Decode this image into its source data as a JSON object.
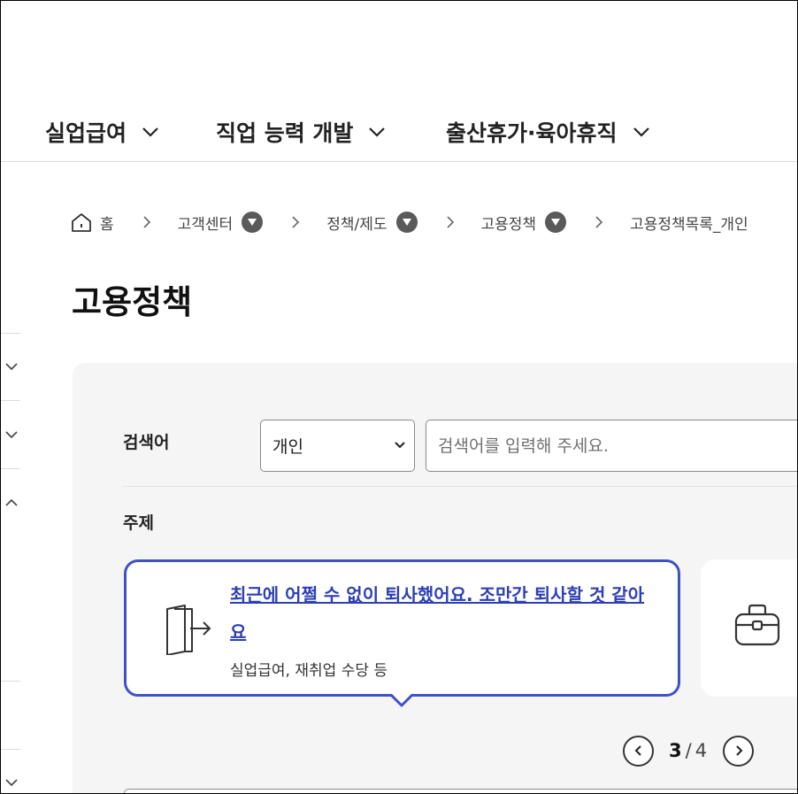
{
  "nav": {
    "items": [
      {
        "label": "실업급여"
      },
      {
        "label": "직업 능력 개발"
      },
      {
        "label": "출산휴가·육아휴직"
      }
    ]
  },
  "breadcrumb": {
    "home": "홈",
    "items": [
      {
        "label": "고객센터",
        "has_dropdown": true
      },
      {
        "label": "정책/제도",
        "has_dropdown": true
      },
      {
        "label": "고용정책",
        "has_dropdown": true
      },
      {
        "label": "고용정책목록_개인",
        "has_dropdown": false
      }
    ]
  },
  "page": {
    "title": "고용정책"
  },
  "search": {
    "label": "검색어",
    "select_value": "개인",
    "placeholder": "검색어를 입력해 주세요."
  },
  "topic": {
    "label": "주제",
    "cards": [
      {
        "title": "최근에 어쩔 수 없이 퇴사했어요. 조만간 퇴사할 것 같아요",
        "subtitle": "실업급여, 재취업 수당 등",
        "icon": "exit-door-icon",
        "selected": true
      },
      {
        "title": "",
        "subtitle": "",
        "icon": "briefcase-icon",
        "selected": false
      }
    ]
  },
  "pager": {
    "current": "3",
    "separator": "/",
    "total": "4"
  },
  "colors": {
    "accent": "#3f51c7",
    "link": "#2c3fb5",
    "panel_bg": "#f5f5f5"
  },
  "icons": {
    "nav_chevron": "chevron-down-icon",
    "home": "home-icon",
    "breadcrumb_separator": "chevron-right-icon",
    "breadcrumb_dropdown": "dropdown-circle-icon"
  }
}
